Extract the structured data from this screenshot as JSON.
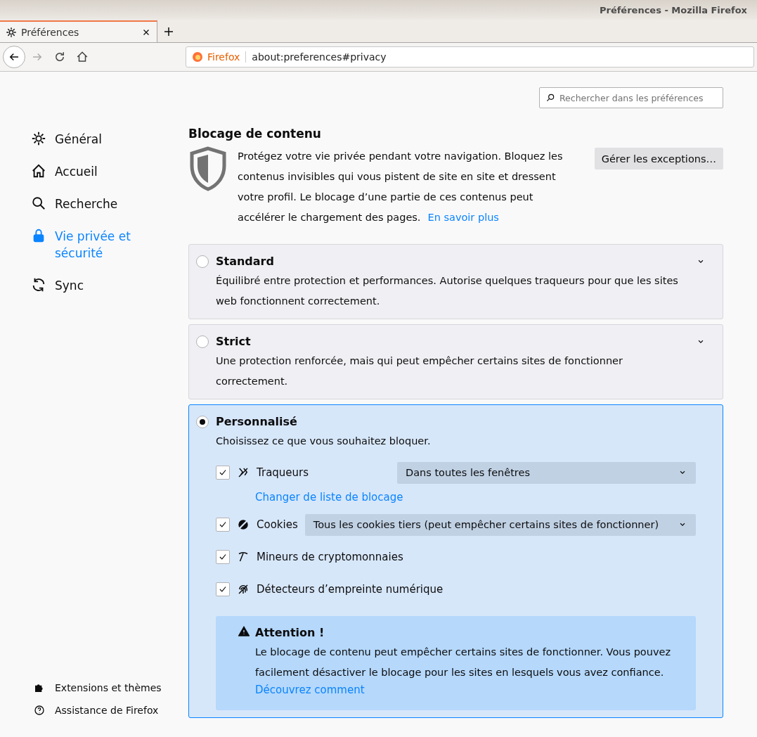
{
  "window": {
    "title": "Préférences - Mozilla Firefox"
  },
  "tabs": [
    {
      "label": "Préférences",
      "selected": true
    }
  ],
  "navbar": {
    "identity": "Firefox",
    "url": "about:preferences#privacy"
  },
  "search": {
    "placeholder": "Rechercher dans les préférences"
  },
  "sidebar": {
    "items": [
      {
        "label": "Général",
        "selected": false
      },
      {
        "label": "Accueil",
        "selected": false
      },
      {
        "label": "Recherche",
        "selected": false
      },
      {
        "label": "Vie privée et sécurité",
        "selected": true
      },
      {
        "label": "Sync",
        "selected": false
      }
    ],
    "footer": [
      {
        "label": "Extensions et thèmes"
      },
      {
        "label": "Assistance de Firefox"
      }
    ]
  },
  "section": {
    "title": "Blocage de contenu",
    "description": "Protégez votre vie privée pendant votre navigation. Bloquez les contenus invisibles qui vous pistent de site en site et dressent votre profil. Le blocage d’une partie de ces contenus peut accélérer le chargement des pages.",
    "link": "En savoir plus",
    "button": "Gérer les exceptions…"
  },
  "options": [
    {
      "label": "Standard",
      "description": "Équilibré entre protection et performances. Autorise quelques traqueurs pour que les sites web fonctionnent correctement.",
      "selected": false
    },
    {
      "label": "Strict",
      "description": "Une protection renforcée, mais qui peut empêcher certains sites de fonctionner correctement.",
      "selected": false
    },
    {
      "label": "Personnalisé",
      "description": "Choisissez ce que vous souhaitez bloquer.",
      "selected": true,
      "items": [
        {
          "label": "Traqueurs",
          "checked": true,
          "select": "Dans toutes les fenêtres",
          "link": "Changer de liste de blocage"
        },
        {
          "label": "Cookies",
          "checked": true,
          "select": "Tous les cookies tiers (peut empêcher certains sites de fonctionner)"
        },
        {
          "label": "Mineurs de cryptomonnaies",
          "checked": true
        },
        {
          "label": "Détecteurs d’empreinte numérique",
          "checked": true
        }
      ],
      "warning": {
        "title": "Attention !",
        "text": "Le blocage de contenu peut empêcher certains sites de fonctionner. Vous pouvez facilement désactiver le blocage pour les sites en lesquels vous avez confiance.",
        "link": "Découvrez comment"
      }
    }
  ]
}
